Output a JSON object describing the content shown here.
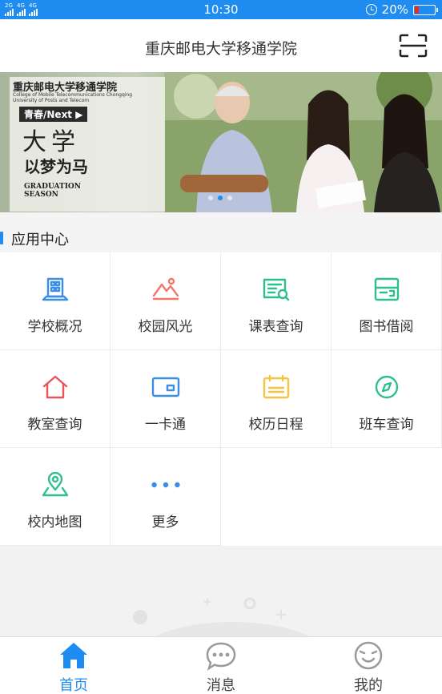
{
  "status_bar": {
    "network_1": "2G",
    "network_2": "4G",
    "network_2b": "4G",
    "time": "10:30",
    "battery": "20%",
    "battery_level": 0.2
  },
  "header": {
    "title": "重庆邮电大学移通学院",
    "scan_icon": "scan-icon"
  },
  "banner": {
    "school_name": "重庆邮电大学移通学院",
    "school_en_1": "College of Mobile Telecommunications Chongqing",
    "school_en_2": "University of Posts and Telecom",
    "tag": "青春/Next ▶",
    "headline": "大学",
    "slogan": "以梦为马",
    "graduation_1": "GRADUATION",
    "graduation_2": "SEASON",
    "active_slide": 1,
    "slide_count": 3
  },
  "section": {
    "title": "应用中心"
  },
  "apps": [
    {
      "label": "学校概况",
      "icon": "school-building-icon",
      "color": "#3a8ee6"
    },
    {
      "label": "校园风光",
      "icon": "landscape-icon",
      "color": "#f07868"
    },
    {
      "label": "课表查询",
      "icon": "timetable-search-icon",
      "color": "#2fbf8f"
    },
    {
      "label": "图书借阅",
      "icon": "library-card-icon",
      "color": "#2fbf8f"
    },
    {
      "label": "教室查询",
      "icon": "house-icon",
      "color": "#e9535a"
    },
    {
      "label": "一卡通",
      "icon": "card-icon",
      "color": "#3a8ee6"
    },
    {
      "label": "校历日程",
      "icon": "calendar-icon",
      "color": "#f5c542"
    },
    {
      "label": "班车查询",
      "icon": "compass-icon",
      "color": "#2fbf8f"
    },
    {
      "label": "校内地图",
      "icon": "map-pin-icon",
      "color": "#2fbf8f"
    },
    {
      "label": "更多",
      "icon": "more-dots-icon",
      "color": "#3a8ee6"
    }
  ],
  "tabs": [
    {
      "label": "首页",
      "icon": "home-icon",
      "active": true
    },
    {
      "label": "消息",
      "icon": "chat-bubble-icon",
      "active": false
    },
    {
      "label": "我的",
      "icon": "profile-face-icon",
      "active": false
    }
  ],
  "colors": {
    "accent": "#1e8cf0",
    "battery_low": "#e52b2b"
  }
}
